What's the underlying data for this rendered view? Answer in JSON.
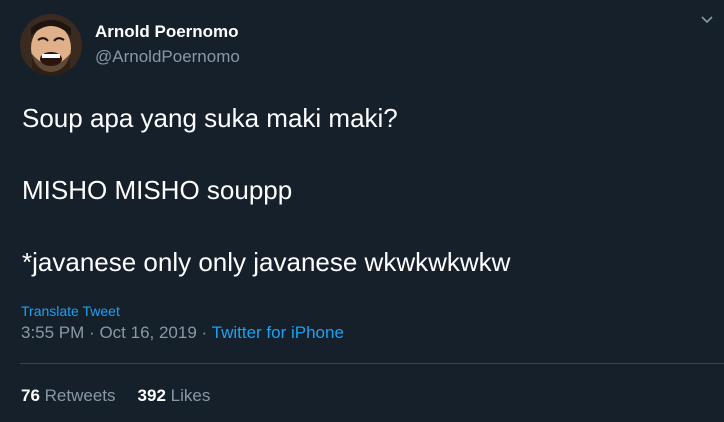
{
  "author": {
    "name": "Arnold Poernomo",
    "handle": "@ArnoldPoernomo"
  },
  "tweet": {
    "lines": [
      "Soup apa yang suka maki maki?",
      "MISHO MISHO souppp",
      "*javanese only only javanese wkwkwkwkw"
    ],
    "translate_label": "Translate Tweet",
    "time": "3:55 PM",
    "separator": "·",
    "date": "Oct 16, 2019",
    "source": "Twitter for iPhone"
  },
  "stats": {
    "retweets_count": "76",
    "retweets_label": "Retweets",
    "likes_count": "392",
    "likes_label": "Likes"
  },
  "icons": {
    "menu": "chevron-down-icon"
  },
  "colors": {
    "background": "#15202b",
    "text": "#ffffff",
    "secondary": "#8899a6",
    "link": "#1da1f2",
    "divider": "#38444d"
  }
}
